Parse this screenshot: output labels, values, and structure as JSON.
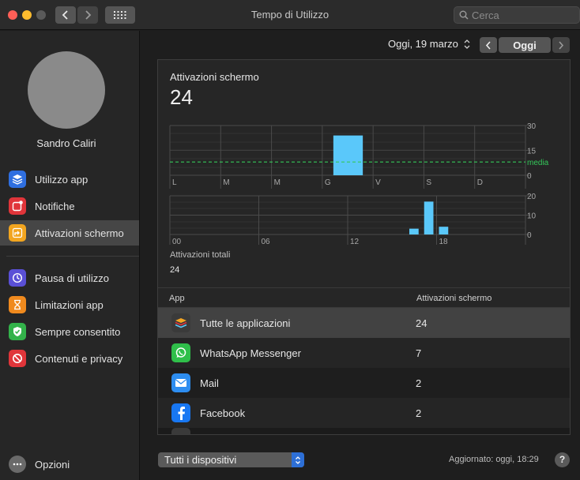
{
  "window": {
    "title": "Tempo di Utilizzo"
  },
  "search": {
    "placeholder": "Cerca"
  },
  "user": {
    "name": "Sandro Caliri"
  },
  "sidebar": {
    "items": [
      {
        "label": "Utilizzo app",
        "icon": "layers-icon",
        "color": "#2f6fe0"
      },
      {
        "label": "Notifiche",
        "icon": "notification-icon",
        "color": "#e0353a"
      },
      {
        "label": "Attivazioni schermo",
        "icon": "pickup-icon",
        "color": "#f2a51f",
        "active": true
      },
      {
        "label": "Pausa di utilizzo",
        "icon": "downtime-icon",
        "color": "#5a50d6"
      },
      {
        "label": "Limitazioni app",
        "icon": "hourglass-icon",
        "color": "#f08a1e"
      },
      {
        "label": "Sempre consentito",
        "icon": "checkmark-shield-icon",
        "color": "#33b24a"
      },
      {
        "label": "Contenuti e privacy",
        "icon": "block-icon",
        "color": "#e0353a"
      }
    ],
    "options_label": "Opzioni"
  },
  "datebar": {
    "date_label": "Oggi, 19 marzo",
    "today_button": "Oggi"
  },
  "chart_data": [
    {
      "type": "bar",
      "title": "Attivazioni schermo",
      "total": "24",
      "categories": [
        "L",
        "M",
        "M",
        "G",
        "V",
        "S",
        "D"
      ],
      "values": [
        0,
        0,
        0,
        24,
        0,
        0,
        0
      ],
      "y_ticks": [
        "30",
        "15",
        "0"
      ],
      "ylim": [
        0,
        30
      ],
      "average_label": "media",
      "average_value": 8
    },
    {
      "type": "bar",
      "x_ticks": [
        "00",
        "06",
        "12",
        "18"
      ],
      "y_ticks": [
        "20",
        "10",
        "0"
      ],
      "ylim": [
        0,
        20
      ],
      "hours": [
        16,
        17,
        18
      ],
      "values": [
        3,
        17,
        4
      ],
      "total_label": "Attivazioni totali",
      "total_value": "24"
    }
  ],
  "table": {
    "headers": {
      "app": "App",
      "activations": "Attivazioni schermo"
    },
    "rows": [
      {
        "name": "Tutte le applicazioni",
        "value": "24",
        "icon": "all-apps-icon"
      },
      {
        "name": "WhatsApp Messenger",
        "value": "7",
        "icon": "whatsapp-icon"
      },
      {
        "name": "Mail",
        "value": "2",
        "icon": "mail-icon"
      },
      {
        "name": "Facebook",
        "value": "2",
        "icon": "facebook-icon"
      }
    ]
  },
  "footer": {
    "device_select": "Tutti i dispositivi",
    "updated": "Aggiornato: oggi, 18:29",
    "help": "?"
  },
  "colors": {
    "bar": "#5ac8fa",
    "average_line": "#34c759"
  }
}
